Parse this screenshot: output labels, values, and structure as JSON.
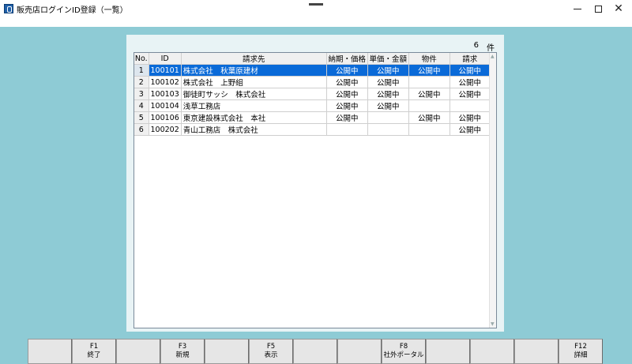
{
  "window": {
    "title": "販売店ログインID登録（一覧）",
    "min_glyph": "—",
    "max_glyph": "□",
    "close_glyph": "✕"
  },
  "summary": {
    "count": "6",
    "unit": "件"
  },
  "table": {
    "headers": [
      "No.",
      "ID",
      "請求先",
      "納期・価格",
      "単価・金額",
      "物件",
      "請求"
    ],
    "rows": [
      {
        "no": "1",
        "id": "100101",
        "name": "株式会社　秋葉原建材",
        "c1": "公開中",
        "c2": "公開中",
        "c3": "公開中",
        "c4": "公開中",
        "selected": true
      },
      {
        "no": "2",
        "id": "100102",
        "name": "株式会社　上野組",
        "c1": "公開中",
        "c2": "公開中",
        "c3": "",
        "c4": "公開中"
      },
      {
        "no": "3",
        "id": "100103",
        "name": "御徒町サッシ　株式会社",
        "c1": "公開中",
        "c2": "公開中",
        "c3": "公開中",
        "c4": "公開中"
      },
      {
        "no": "4",
        "id": "100104",
        "name": "浅草工務店",
        "c1": "公開中",
        "c2": "公開中",
        "c3": "",
        "c4": ""
      },
      {
        "no": "5",
        "id": "100106",
        "name": "東京建設株式会社　本社",
        "c1": "公開中",
        "c2": "",
        "c3": "公開中",
        "c4": "公開中"
      },
      {
        "no": "6",
        "id": "100202",
        "name": "青山工務店　株式会社",
        "c1": "",
        "c2": "",
        "c3": "",
        "c4": "公開中"
      }
    ]
  },
  "fkeys": [
    {
      "key": "",
      "label": ""
    },
    {
      "key": "F1",
      "label": "終了"
    },
    {
      "key": "",
      "label": ""
    },
    {
      "key": "F3",
      "label": "新規"
    },
    {
      "key": "",
      "label": ""
    },
    {
      "key": "F5",
      "label": "表示"
    },
    {
      "key": "",
      "label": ""
    },
    {
      "key": "",
      "label": ""
    },
    {
      "key": "F8",
      "label": "社外ポータル"
    },
    {
      "key": "",
      "label": ""
    },
    {
      "key": "",
      "label": ""
    },
    {
      "key": "",
      "label": ""
    },
    {
      "key": "F12",
      "label": "詳細"
    }
  ],
  "colors": {
    "background": "#8ecbd5",
    "panel": "#e8f3f5",
    "selection": "#0a6ad8"
  }
}
